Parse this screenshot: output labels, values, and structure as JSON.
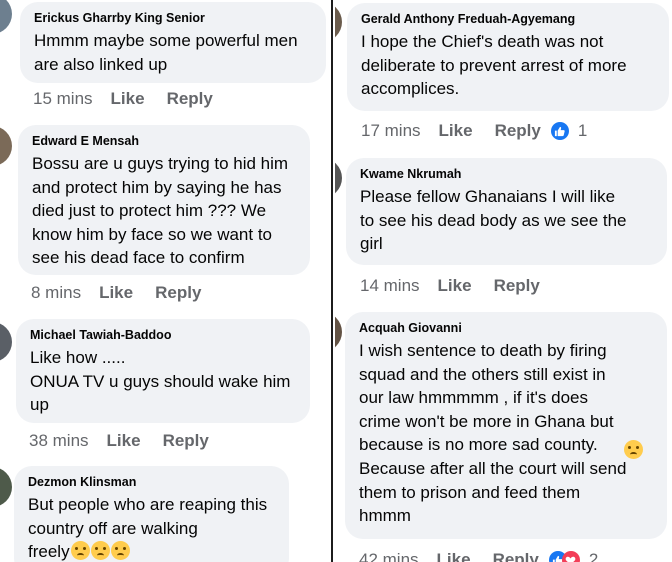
{
  "left_comments": [
    {
      "author": "Erickus Gharrby King Senior",
      "text": "Hmmm maybe some powerful men\nare also linked up",
      "time": "15 mins",
      "like": "Like",
      "reply": "Reply"
    },
    {
      "author": "Edward E Mensah",
      "text": "Bossu are u guys trying to hid him\nand protect him by saying he has\ndied just to protect him ??? We\nknow him by face so we want to\nsee his dead face to confirm",
      "time": "8 mins",
      "like": "Like",
      "reply": "Reply"
    },
    {
      "author": "Michael Tawiah-Baddoo",
      "text": "Like how .....\nONUA TV u guys should wake him\nup",
      "time": "38 mins",
      "like": "Like",
      "reply": "Reply"
    },
    {
      "author": "Dezmon Klinsman",
      "text": "But people who are reaping this\ncountry off are walking\nfreely",
      "time": "",
      "like": "",
      "reply": ""
    }
  ],
  "right_comments": [
    {
      "author": "Gerald Anthony Freduah-Agyemang",
      "text": "I hope the Chief's death was not\ndeliberate to prevent arrest of more\naccomplices.",
      "time": "17 mins",
      "like": "Like",
      "reply": "Reply",
      "reactions": "1"
    },
    {
      "author": "Kwame Nkrumah",
      "text": "Please fellow Ghanaians I will like\nto see his dead body as we see the\ngirl",
      "time": "14 mins",
      "like": "Like",
      "reply": "Reply"
    },
    {
      "author": "Acquah Giovanni",
      "text": "I wish sentence to death by firing\nsquad and the others still exist in\nour law hmmmmm , if it's does\ncrime won't be more in Ghana but\nbecause is no more sad county.\nBecause after all the court will send\nthem to prison and feed them\nhmmm",
      "time": "42 mins",
      "like": "Like",
      "reply": "Reply",
      "reactions": "2"
    }
  ],
  "emoji_names": [
    "pleading-face-emoji",
    "rolling-eyes-emoji"
  ],
  "colors": {
    "bubble": "#f0f2f5",
    "meta": "#65676b",
    "like_blue": "#1877f2",
    "love_red": "#f33e58"
  }
}
